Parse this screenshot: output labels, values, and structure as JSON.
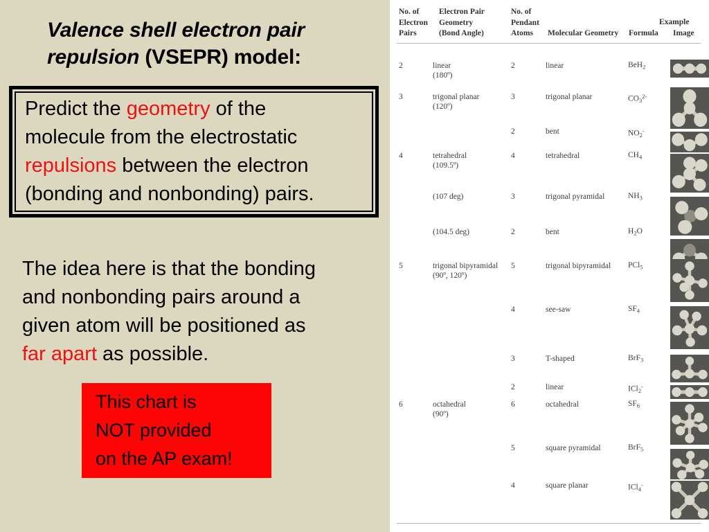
{
  "slide": {
    "background_color": "#dcd8c0",
    "title_italic": "Valence shell electron pair repulsion",
    "title_rest": " (VSEPR) model:"
  },
  "definition": {
    "line1_a": "Predict the ",
    "line1_hl": "geometry",
    "line1_b": " of the",
    "line2": "molecule from the electrostatic",
    "line3_hl": "repulsions",
    "line3_b": " between the electron",
    "line4": "(bonding and nonbonding) pairs.",
    "highlight_color": "#ee1111"
  },
  "idea": {
    "line1": "The idea here is that the bonding",
    "line2": "and nonbonding pairs around a",
    "line3": "given atom will be positioned as",
    "line4_hl": "far apart",
    "line4_b": " as possible."
  },
  "warning": {
    "background_color": "#fc0505",
    "line1": "This chart is",
    "line2": "NOT provided",
    "line3": "on the AP exam!"
  },
  "table": {
    "header": {
      "pairs_l1": "No. of",
      "pairs_l2": "Electron",
      "pairs_l3": "Pairs",
      "epgeom_l1": "Electron Pair",
      "epgeom_l2": "Geometry",
      "epgeom_l3": "(Bond Angle)",
      "pendant_l1": "No. of",
      "pendant_l2": "Pendant",
      "pendant_l3": "Atoms",
      "molgeom": "Molecular Geometry",
      "example": "Example",
      "formula": "Formula",
      "image": "Image"
    },
    "rows": [
      {
        "pairs": "2",
        "ep_geom": "linear",
        "ep_angle": "(180º)",
        "pendant": "2",
        "mol_geom": "linear",
        "formula_base": "BeH",
        "formula_sub": "2",
        "formula_sup": "",
        "image": "beh2-linear-image"
      },
      {
        "pairs": "3",
        "ep_geom": "trigonal planar",
        "ep_angle": "(120º)",
        "pendant": "3",
        "mol_geom": "trigonal planar",
        "formula_base": "CO",
        "formula_sub": "3",
        "formula_sup": "2-",
        "image": "co3-trigonal-planar-image"
      },
      {
        "pairs": "",
        "ep_geom": "",
        "ep_angle": "",
        "pendant": "2",
        "mol_geom": "bent",
        "formula_base": "NO",
        "formula_sub": "2",
        "formula_sup": "-",
        "image": "no2-bent-image"
      },
      {
        "pairs": "4",
        "ep_geom": "tetrahedral",
        "ep_angle": "(109.5º)",
        "pendant": "4",
        "mol_geom": "tetrahedral",
        "formula_base": "CH",
        "formula_sub": "4",
        "formula_sup": "",
        "image": "ch4-tetrahedral-image"
      },
      {
        "pairs": "",
        "ep_geom": "",
        "ep_angle": "(107 deg)",
        "pendant": "3",
        "mol_geom": "trigonal pyramidal",
        "formula_base": "NH",
        "formula_sub": "3",
        "formula_sup": "",
        "image": "nh3-trigonal-pyramidal-image"
      },
      {
        "pairs": "",
        "ep_geom": "",
        "ep_angle": "(104.5 deg)",
        "pendant": "2",
        "mol_geom": "bent",
        "formula_base": "H",
        "formula_sub": "2",
        "formula_sup": "",
        "formula_tail": "O",
        "image": "h2o-bent-image"
      },
      {
        "pairs": "5",
        "ep_geom": "trigonal bipyramidal",
        "ep_angle": "(90º, 120º)",
        "pendant": "5",
        "mol_geom": "trigonal bipyramidal",
        "formula_base": "PCl",
        "formula_sub": "5",
        "formula_sup": "",
        "image": "pcl5-trigonal-bipyramidal-image"
      },
      {
        "pairs": "",
        "ep_geom": "",
        "ep_angle": "",
        "pendant": "4",
        "mol_geom": "see-saw",
        "formula_base": "SF",
        "formula_sub": "4",
        "formula_sup": "",
        "image": "sf4-see-saw-image"
      },
      {
        "pairs": "",
        "ep_geom": "",
        "ep_angle": "",
        "pendant": "3",
        "mol_geom": "T-shaped",
        "formula_base": "BrF",
        "formula_sub": "3",
        "formula_sup": "",
        "image": "brf3-t-shaped-image"
      },
      {
        "pairs": "",
        "ep_geom": "",
        "ep_angle": "",
        "pendant": "2",
        "mol_geom": "linear",
        "formula_base": "ICl",
        "formula_sub": "2",
        "formula_sup": "-",
        "image": "icl2-linear-image"
      },
      {
        "pairs": "6",
        "ep_geom": "octahedral",
        "ep_angle": "(90º)",
        "pendant": "6",
        "mol_geom": "octahedral",
        "formula_base": "SF",
        "formula_sub": "6",
        "formula_sup": "",
        "image": "sf6-octahedral-image"
      },
      {
        "pairs": "",
        "ep_geom": "",
        "ep_angle": "",
        "pendant": "5",
        "mol_geom": "square pyramidal",
        "formula_base": "BrF",
        "formula_sub": "5",
        "formula_sup": "",
        "image": "brf5-square-pyramidal-image"
      },
      {
        "pairs": "",
        "ep_geom": "",
        "ep_angle": "",
        "pendant": "4",
        "mol_geom": "square planar",
        "formula_base": "ICl",
        "formula_sub": "4",
        "formula_sup": "-",
        "image": "icl4-square-planar-image"
      }
    ]
  }
}
